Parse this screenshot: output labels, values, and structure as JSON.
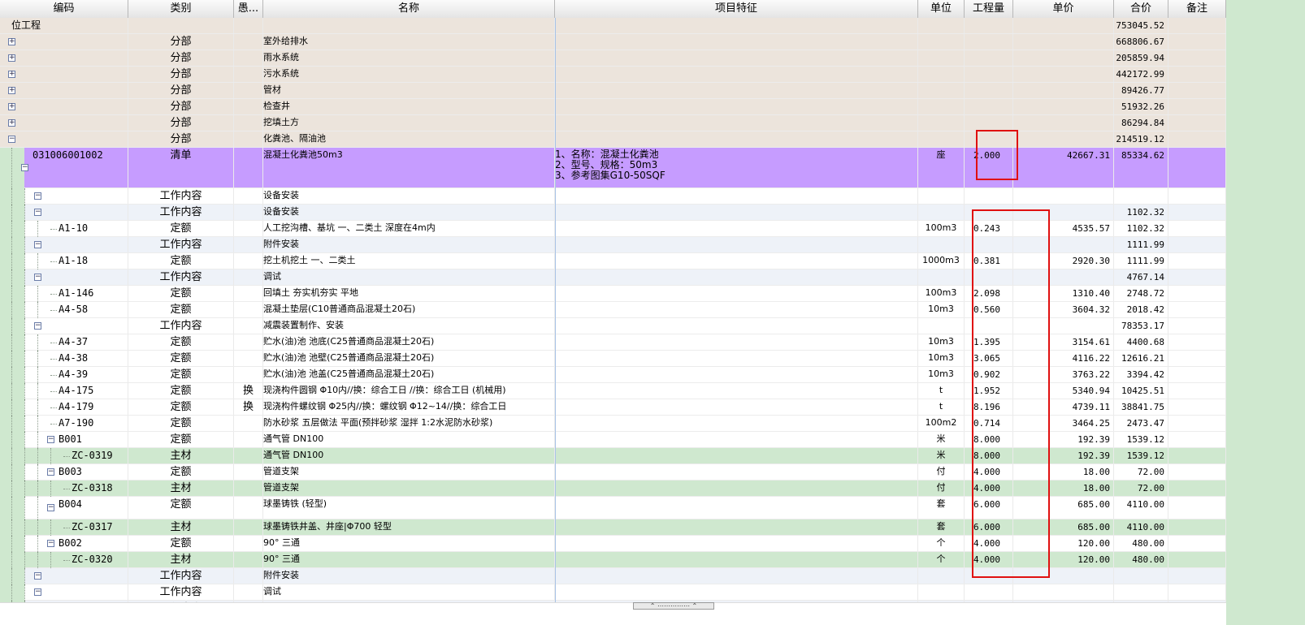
{
  "headers": {
    "code": "编码",
    "type": "类别",
    "flag": "愚...",
    "name": "名称",
    "features": "项目特征",
    "unit": "单位",
    "qty": "工程量",
    "price": "单价",
    "total": "合价",
    "note": "备注"
  },
  "colors": {
    "summary": "#ece4dc",
    "qingdan": "#c69cff",
    "zhucai": "#cfe8cf",
    "workcontent_odd": "#eef2f8",
    "white": "#ffffff",
    "highlight": "#e01010"
  },
  "splitter_glyph": "⌃ ⋯⋯⋯⋯⋯ ⌃",
  "rows": [
    {
      "code": "位工程",
      "type": "",
      "name": "",
      "features": "",
      "unit": "",
      "qty": "",
      "price": "",
      "total": "753045.52",
      "kind": "summary"
    },
    {
      "code": "",
      "type": "分部",
      "name": "室外给排水",
      "features": "",
      "unit": "",
      "qty": "",
      "price": "",
      "total": "668806.67",
      "kind": "summary"
    },
    {
      "code": "",
      "type": "分部",
      "name": "雨水系统",
      "features": "",
      "unit": "",
      "qty": "",
      "price": "",
      "total": "205859.94",
      "kind": "summary"
    },
    {
      "code": "",
      "type": "分部",
      "name": "污水系统",
      "features": "",
      "unit": "",
      "qty": "",
      "price": "",
      "total": "442172.99",
      "kind": "summary"
    },
    {
      "code": "",
      "type": "分部",
      "name": "管材",
      "features": "",
      "unit": "",
      "qty": "",
      "price": "",
      "total": "89426.77",
      "kind": "summary"
    },
    {
      "code": "",
      "type": "分部",
      "name": "检查井",
      "features": "",
      "unit": "",
      "qty": "",
      "price": "",
      "total": "51932.26",
      "kind": "summary"
    },
    {
      "code": "",
      "type": "分部",
      "name": "挖填土方",
      "features": "",
      "unit": "",
      "qty": "",
      "price": "",
      "total": "86294.84",
      "kind": "summary"
    },
    {
      "code": "",
      "type": "分部",
      "name": "化粪池、隔油池",
      "features": "",
      "unit": "",
      "qty": "",
      "price": "",
      "total": "214519.12",
      "kind": "summary"
    },
    {
      "code": "031006001002",
      "type": "清单",
      "name": "混凝土化粪池50m3",
      "features": "1、名称：混凝土化粪池\n2、型号、规格：50m3\n3、参考图集G10-50SQF",
      "unit": "座",
      "qty": "2.000",
      "price": "42667.31",
      "total": "85334.62",
      "kind": "qingdan"
    },
    {
      "code": "",
      "type": "工作内容",
      "name": "设备安装",
      "features": "",
      "unit": "",
      "qty": "",
      "price": "",
      "total": "",
      "kind": "work"
    },
    {
      "code": "",
      "type": "工作内容",
      "name": "设备安装",
      "features": "",
      "unit": "",
      "qty": "",
      "price": "",
      "total": "1102.32",
      "kind": "work"
    },
    {
      "code": "A1-10",
      "type": "定额",
      "name": "人工挖沟槽、基坑 一、二类土 深度在4m内",
      "features": "",
      "unit": "100m3",
      "qty": "0.243",
      "price": "4535.57",
      "total": "1102.32",
      "kind": "white"
    },
    {
      "code": "",
      "type": "工作内容",
      "name": "附件安装",
      "features": "",
      "unit": "",
      "qty": "",
      "price": "",
      "total": "1111.99",
      "kind": "work"
    },
    {
      "code": "A1-18",
      "type": "定额",
      "name": "挖土机挖土 一、二类土",
      "features": "",
      "unit": "1000m3",
      "qty": "0.381",
      "price": "2920.30",
      "total": "1111.99",
      "kind": "white"
    },
    {
      "code": "",
      "type": "工作内容",
      "name": "调试",
      "features": "",
      "unit": "",
      "qty": "",
      "price": "",
      "total": "4767.14",
      "kind": "work"
    },
    {
      "code": "A1-146",
      "type": "定额",
      "name": "回填土 夯实机夯实 平地",
      "features": "",
      "unit": "100m3",
      "qty": "2.098",
      "price": "1310.40",
      "total": "2748.72",
      "kind": "white"
    },
    {
      "code": "A4-58",
      "type": "定额",
      "name": "混凝土垫层(C10普通商品混凝土20石)",
      "features": "",
      "unit": "10m3",
      "qty": "0.560",
      "price": "3604.32",
      "total": "2018.42",
      "kind": "white"
    },
    {
      "code": "",
      "type": "工作内容",
      "name": "减震装置制作、安装",
      "features": "",
      "unit": "",
      "qty": "",
      "price": "",
      "total": "78353.17",
      "kind": "work"
    },
    {
      "code": "A4-37",
      "type": "定额",
      "name": "贮水(油)池 池底(C25普通商品混凝土20石)",
      "features": "",
      "unit": "10m3",
      "qty": "1.395",
      "price": "3154.61",
      "total": "4400.68",
      "kind": "white"
    },
    {
      "code": "A4-38",
      "type": "定额",
      "name": "贮水(油)池 池壁(C25普通商品混凝土20石)",
      "features": "",
      "unit": "10m3",
      "qty": "3.065",
      "price": "4116.22",
      "total": "12616.21",
      "kind": "white"
    },
    {
      "code": "A4-39",
      "type": "定额",
      "name": "贮水(油)池 池盖(C25普通商品混凝土20石)",
      "features": "",
      "unit": "10m3",
      "qty": "0.902",
      "price": "3763.22",
      "total": "3394.42",
      "kind": "white"
    },
    {
      "code": "A4-175",
      "type": "定额",
      "flag": "换",
      "name": "现浇构件圆钢 Φ10内//换：综合工日 //换：综合工日 (机械用)",
      "features": "",
      "unit": "t",
      "qty": "1.952",
      "price": "5340.94",
      "total": "10425.51",
      "kind": "white"
    },
    {
      "code": "A4-179",
      "type": "定额",
      "flag": "换",
      "name": "现浇构件螺纹钢 Φ25内//换：螺纹钢 Φ12~14//换：综合工日",
      "features": "",
      "unit": "t",
      "qty": "8.196",
      "price": "4739.11",
      "total": "38841.75",
      "kind": "white"
    },
    {
      "code": "A7-190",
      "type": "定额",
      "name": "防水砂浆 五层做法 平面(预拌砂浆 湿拌 1:2水泥防水砂浆)",
      "features": "",
      "unit": "100m2",
      "qty": "0.714",
      "price": "3464.25",
      "total": "2473.47",
      "kind": "white"
    },
    {
      "code": "B001",
      "type": "定额",
      "name": "通气管 DN100",
      "features": "",
      "unit": "米",
      "qty": "8.000",
      "price": "192.39",
      "total": "1539.12",
      "kind": "white"
    },
    {
      "code": "ZC-0319",
      "type": "主材",
      "name": "通气管 DN100",
      "features": "",
      "unit": "米",
      "qty": "8.000",
      "price": "192.39",
      "total": "1539.12",
      "kind": "zhucai"
    },
    {
      "code": "B003",
      "type": "定额",
      "name": "管道支架",
      "features": "",
      "unit": "付",
      "qty": "4.000",
      "price": "18.00",
      "total": "72.00",
      "kind": "white"
    },
    {
      "code": "ZC-0318",
      "type": "主材",
      "name": "管道支架",
      "features": "",
      "unit": "付",
      "qty": "4.000",
      "price": "18.00",
      "total": "72.00",
      "kind": "zhucai"
    },
    {
      "code": "B004",
      "type": "定额",
      "name": "球墨铸铁 (轻型)",
      "features": "",
      "unit": "套",
      "qty": "6.000",
      "price": "685.00",
      "total": "4110.00",
      "kind": "white"
    },
    {
      "code": "ZC-0317",
      "type": "主材",
      "name": "球墨铸铁井盖、井座|Φ700 轻型",
      "features": "",
      "unit": "套",
      "qty": "6.000",
      "price": "685.00",
      "total": "4110.00",
      "kind": "zhucai"
    },
    {
      "code": "B002",
      "type": "定额",
      "name": "90° 三通",
      "features": "",
      "unit": "个",
      "qty": "4.000",
      "price": "120.00",
      "total": "480.00",
      "kind": "white"
    },
    {
      "code": "ZC-0320",
      "type": "主材",
      "name": "90° 三通",
      "features": "",
      "unit": "个",
      "qty": "4.000",
      "price": "120.00",
      "total": "480.00",
      "kind": "zhucai"
    },
    {
      "code": "",
      "type": "工作内容",
      "name": "附件安装",
      "features": "",
      "unit": "",
      "qty": "",
      "price": "",
      "total": "",
      "kind": "work"
    },
    {
      "code": "",
      "type": "工作内容",
      "name": "调试",
      "features": "",
      "unit": "",
      "qty": "",
      "price": "",
      "total": "",
      "kind": "work"
    },
    {
      "code": "",
      "type": "工作内容",
      "name": "减震装置制作、安装",
      "features": "",
      "unit": "",
      "qty": "",
      "price": "",
      "total": "",
      "kind": "work"
    }
  ]
}
